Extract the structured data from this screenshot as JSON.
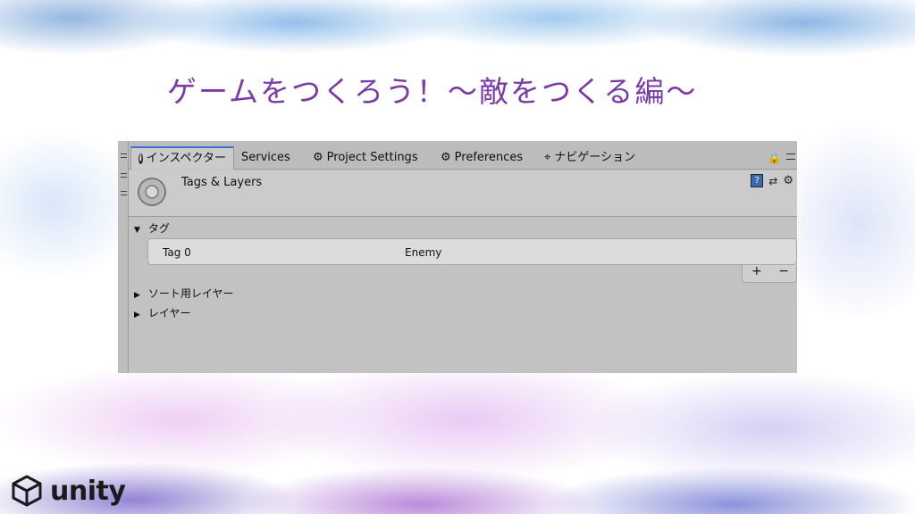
{
  "slide": {
    "title": "ゲームをつくろう！～敵をつくる編～",
    "brand": "unity"
  },
  "inspector": {
    "tabs": [
      {
        "label": "インスペクター",
        "icon": "info-icon",
        "active": true
      },
      {
        "label": "Services",
        "icon": "",
        "active": false
      },
      {
        "label": "Project Settings",
        "icon": "cog-icon",
        "active": false
      },
      {
        "label": "Preferences",
        "icon": "cog-icon",
        "active": false
      },
      {
        "label": "ナビゲーション",
        "icon": "navigation-icon",
        "active": false
      }
    ],
    "header_title": "Tags & Layers",
    "sections": {
      "tags": "タグ",
      "sorting_layers": "ソート用レイヤー",
      "layers": "レイヤー"
    },
    "tag_row": {
      "label": "Tag 0",
      "value": "Enemy"
    },
    "list_buttons": {
      "add": "+",
      "remove": "−"
    }
  },
  "colors": {
    "title": "#7a3aa8",
    "active_tab_accent": "#3a72d8"
  }
}
